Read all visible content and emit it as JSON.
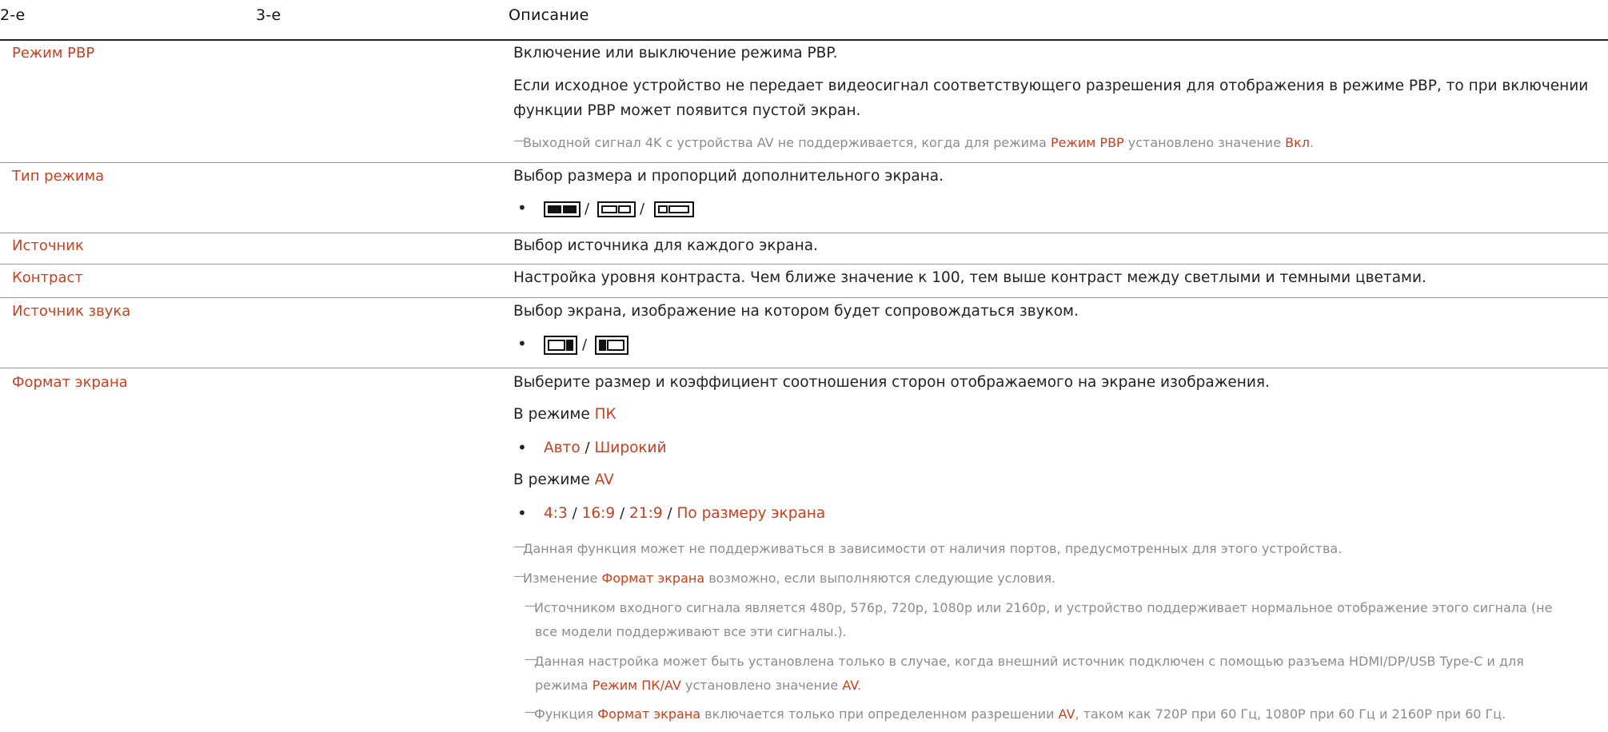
{
  "header": {
    "col2": "2-е",
    "col3": "3-е",
    "col4": "Описание"
  },
  "rows": {
    "pbp_mode": {
      "label": "Режим PBP",
      "desc": "Включение или выключение режима PBP.",
      "desc2a": "Если исходное устройство не передает видеосигнал соответствующего разрешения для отображения в режиме PBP, то при включении",
      "desc2b": "функции PBP может появится пустой экран.",
      "note_a": "Выходной сигнал 4K с устройства AV не поддерживается, когда для режима ",
      "note_hl1": "Режим PBP",
      "note_b": " установлено значение ",
      "note_hl2": "Вкл",
      "note_c": "."
    },
    "mode_type": {
      "label": "Тип режима",
      "desc": "Выбор размера и пропорций дополнительного экрана.",
      "icons": [
        "split-equal-icon",
        "split-outline-icon",
        "split-small-left-icon"
      ]
    },
    "source": {
      "label": "Источник",
      "desc": "Выбор источника для каждого экрана."
    },
    "contrast": {
      "label": "Контраст",
      "desc": "Настройка уровня контраста. Чем ближе значение к 100, тем выше контраст между светлыми и темными цветами."
    },
    "sound_source": {
      "label": "Источник звука",
      "desc": "Выбор экрана, изображение на котором будет сопровождаться звуком.",
      "icons": [
        "sound-left-screen-icon",
        "sound-right-screen-icon"
      ]
    },
    "screen_format": {
      "label": "Формат экрана",
      "desc": "Выберите размер и коэффициент соотношения сторон отображаемого на экране изображения.",
      "pc_prefix": "В режиме ",
      "pc_hl": "ПК",
      "pc_opts": [
        "Авто",
        "Широкий"
      ],
      "av_prefix": "В режиме ",
      "av_hl": "AV",
      "av_opts": [
        "4:3",
        "16:9",
        "21:9",
        "По размеру экрана"
      ],
      "n1": "Данная функция может не поддерживаться в зависимости от наличия портов, предусмотренных для этого устройства.",
      "n2a": "Изменение ",
      "n2hl": "Формат экрана",
      "n2b": " возможно, если выполняются следующие условия.",
      "n3a": "Источником входного сигнала является 480p, 576p, 720p, 1080p или 2160p, и устройство поддерживает нормальное отображение этого сигнала (не",
      "n3b": "все модели поддерживают все эти сигналы.).",
      "n4a": "Данная настройка может быть установлена только в случае, когда внешний источник подключен с помощью разъема HDMI/DP/USB Type-C и для",
      "n4b_a": "режима ",
      "n4b_hl1": "Режим ПК/AV",
      "n4b_b": " установлено значение ",
      "n4b_hl2": "AV",
      "n4b_c": ".",
      "n5a": "Функция ",
      "n5hl1": "Формат экрана",
      "n5b": " включается только при определенном разрешении ",
      "n5hl2": "AV",
      "n5c": ", таком как 720P при 60 Гц, 1080P при 60 Гц и 2160P при 60 Гц."
    }
  },
  "colors": {
    "accent": "#c8401e",
    "note": "#8c8c8c",
    "text": "#222222"
  }
}
